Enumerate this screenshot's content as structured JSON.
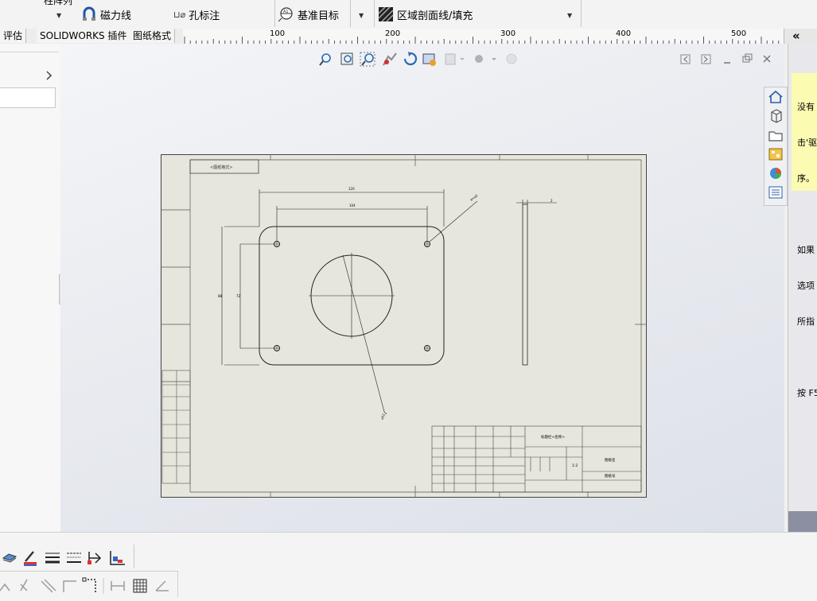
{
  "ribbon": {
    "partial_top_text": "柱阵列",
    "magnet_line": "磁力线",
    "hole_callout_prefix": "⊔⌀",
    "hole_callout": "孔标注",
    "datum_target": "基准目标",
    "area_hatch": "区域剖面线/填充"
  },
  "tabs": [
    "评估",
    "SOLIDWORKS 插件",
    "图纸格式"
  ],
  "ruler": {
    "marks": [
      "100",
      "200",
      "300",
      "400",
      "500"
    ],
    "collapse": "«"
  },
  "task_pane_text": [
    "没有",
    "击'驱",
    "序。",
    "",
    "如果",
    "选项",
    "所指",
    "",
    "按 F5"
  ],
  "colors": {
    "sheet": "#e6e6dc",
    "tip_yellow": "#fbfbb2",
    "ribbon": "#f3f3f3"
  },
  "drawing": {
    "dim_top_outer": "120",
    "dim_top_inner": "104",
    "dim_left_outer": "88",
    "dim_left_inner": "72",
    "hole_note": "4×⌀5",
    "circle_note": "⌀52",
    "thickness": "2",
    "title_block_top": "标题栏<名称>",
    "title_block_mid": "图纸名",
    "title_block_bottom": "图纸号",
    "format_label": "<图纸格式>",
    "scale": "1:2"
  }
}
